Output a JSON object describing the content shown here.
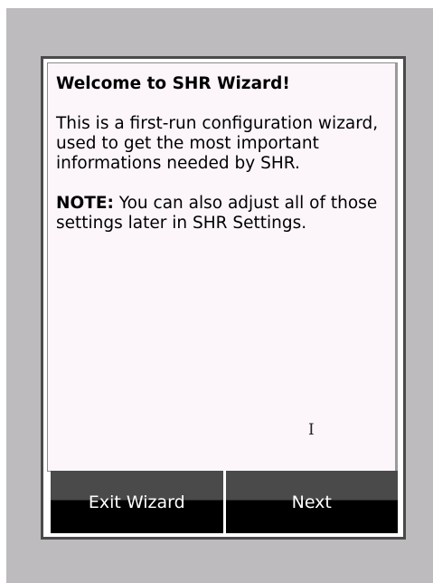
{
  "dialog": {
    "title": "Welcome to SHR Wizard!",
    "intro": "This is a first-run configuration wizard, used to get the most important informations needed by SHR.",
    "note_label": "NOTE:",
    "note_text": " You can also adjust all of those settings later in SHR Settings.",
    "cursor_glyph": "I"
  },
  "buttons": {
    "exit_label": "Exit Wizard",
    "next_label": "Next"
  },
  "colors": {
    "screen_bg": "#bdbbbd",
    "frame": "#4a4a4a",
    "content_bg": "#fcf6fb",
    "button_top": "#4a4a4a",
    "button_bottom": "#000000"
  }
}
